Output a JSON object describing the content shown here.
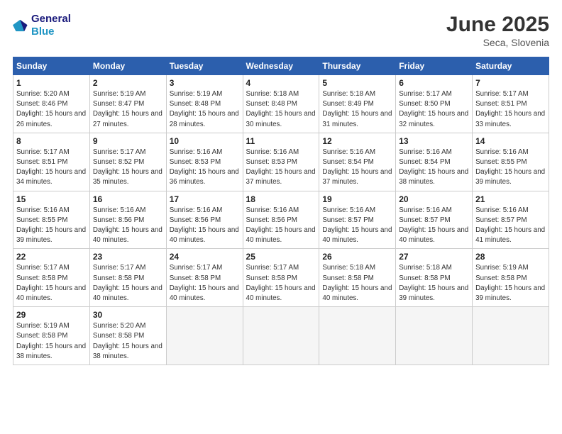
{
  "header": {
    "logo_line1": "General",
    "logo_line2": "Blue",
    "month_title": "June 2025",
    "location": "Seca, Slovenia"
  },
  "days_of_week": [
    "Sunday",
    "Monday",
    "Tuesday",
    "Wednesday",
    "Thursday",
    "Friday",
    "Saturday"
  ],
  "weeks": [
    [
      {
        "day": 1,
        "sunrise": "5:20 AM",
        "sunset": "8:46 PM",
        "daylight": "15 hours and 26 minutes."
      },
      {
        "day": 2,
        "sunrise": "5:19 AM",
        "sunset": "8:47 PM",
        "daylight": "15 hours and 27 minutes."
      },
      {
        "day": 3,
        "sunrise": "5:19 AM",
        "sunset": "8:48 PM",
        "daylight": "15 hours and 28 minutes."
      },
      {
        "day": 4,
        "sunrise": "5:18 AM",
        "sunset": "8:48 PM",
        "daylight": "15 hours and 30 minutes."
      },
      {
        "day": 5,
        "sunrise": "5:18 AM",
        "sunset": "8:49 PM",
        "daylight": "15 hours and 31 minutes."
      },
      {
        "day": 6,
        "sunrise": "5:17 AM",
        "sunset": "8:50 PM",
        "daylight": "15 hours and 32 minutes."
      },
      {
        "day": 7,
        "sunrise": "5:17 AM",
        "sunset": "8:51 PM",
        "daylight": "15 hours and 33 minutes."
      }
    ],
    [
      {
        "day": 8,
        "sunrise": "5:17 AM",
        "sunset": "8:51 PM",
        "daylight": "15 hours and 34 minutes."
      },
      {
        "day": 9,
        "sunrise": "5:17 AM",
        "sunset": "8:52 PM",
        "daylight": "15 hours and 35 minutes."
      },
      {
        "day": 10,
        "sunrise": "5:16 AM",
        "sunset": "8:53 PM",
        "daylight": "15 hours and 36 minutes."
      },
      {
        "day": 11,
        "sunrise": "5:16 AM",
        "sunset": "8:53 PM",
        "daylight": "15 hours and 37 minutes."
      },
      {
        "day": 12,
        "sunrise": "5:16 AM",
        "sunset": "8:54 PM",
        "daylight": "15 hours and 37 minutes."
      },
      {
        "day": 13,
        "sunrise": "5:16 AM",
        "sunset": "8:54 PM",
        "daylight": "15 hours and 38 minutes."
      },
      {
        "day": 14,
        "sunrise": "5:16 AM",
        "sunset": "8:55 PM",
        "daylight": "15 hours and 39 minutes."
      }
    ],
    [
      {
        "day": 15,
        "sunrise": "5:16 AM",
        "sunset": "8:55 PM",
        "daylight": "15 hours and 39 minutes."
      },
      {
        "day": 16,
        "sunrise": "5:16 AM",
        "sunset": "8:56 PM",
        "daylight": "15 hours and 40 minutes."
      },
      {
        "day": 17,
        "sunrise": "5:16 AM",
        "sunset": "8:56 PM",
        "daylight": "15 hours and 40 minutes."
      },
      {
        "day": 18,
        "sunrise": "5:16 AM",
        "sunset": "8:56 PM",
        "daylight": "15 hours and 40 minutes."
      },
      {
        "day": 19,
        "sunrise": "5:16 AM",
        "sunset": "8:57 PM",
        "daylight": "15 hours and 40 minutes."
      },
      {
        "day": 20,
        "sunrise": "5:16 AM",
        "sunset": "8:57 PM",
        "daylight": "15 hours and 40 minutes."
      },
      {
        "day": 21,
        "sunrise": "5:16 AM",
        "sunset": "8:57 PM",
        "daylight": "15 hours and 41 minutes."
      }
    ],
    [
      {
        "day": 22,
        "sunrise": "5:17 AM",
        "sunset": "8:58 PM",
        "daylight": "15 hours and 40 minutes."
      },
      {
        "day": 23,
        "sunrise": "5:17 AM",
        "sunset": "8:58 PM",
        "daylight": "15 hours and 40 minutes."
      },
      {
        "day": 24,
        "sunrise": "5:17 AM",
        "sunset": "8:58 PM",
        "daylight": "15 hours and 40 minutes."
      },
      {
        "day": 25,
        "sunrise": "5:17 AM",
        "sunset": "8:58 PM",
        "daylight": "15 hours and 40 minutes."
      },
      {
        "day": 26,
        "sunrise": "5:18 AM",
        "sunset": "8:58 PM",
        "daylight": "15 hours and 40 minutes."
      },
      {
        "day": 27,
        "sunrise": "5:18 AM",
        "sunset": "8:58 PM",
        "daylight": "15 hours and 39 minutes."
      },
      {
        "day": 28,
        "sunrise": "5:19 AM",
        "sunset": "8:58 PM",
        "daylight": "15 hours and 39 minutes."
      }
    ],
    [
      {
        "day": 29,
        "sunrise": "5:19 AM",
        "sunset": "8:58 PM",
        "daylight": "15 hours and 38 minutes."
      },
      {
        "day": 30,
        "sunrise": "5:20 AM",
        "sunset": "8:58 PM",
        "daylight": "15 hours and 38 minutes."
      },
      null,
      null,
      null,
      null,
      null
    ]
  ]
}
